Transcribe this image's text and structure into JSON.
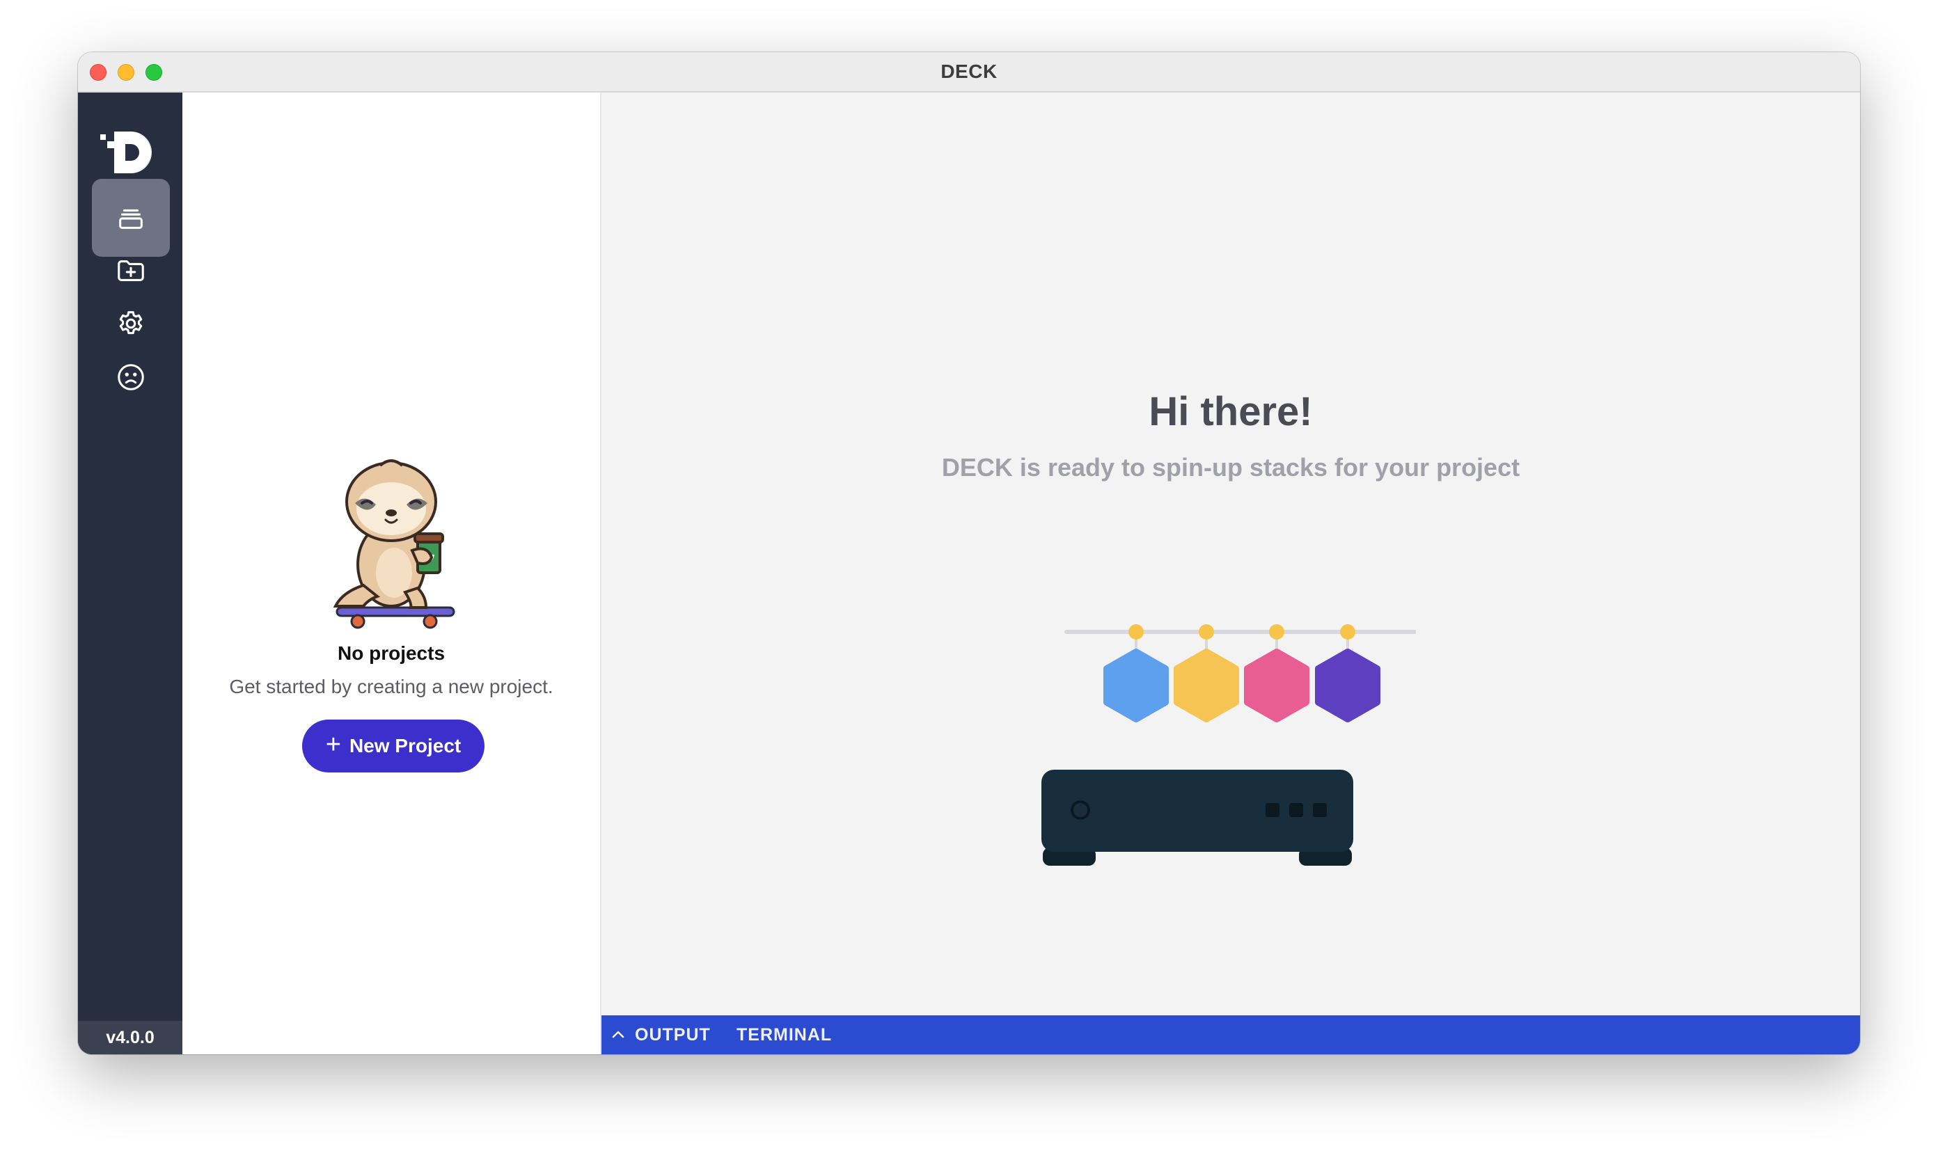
{
  "window": {
    "title": "DECK"
  },
  "rail": {
    "items": [
      {
        "name": "projects",
        "icon": "stack-icon",
        "active": true
      },
      {
        "name": "import-project",
        "icon": "folder-plus-icon",
        "active": false
      },
      {
        "name": "settings",
        "icon": "gear-icon",
        "active": false
      },
      {
        "name": "feedback",
        "icon": "sad-face-icon",
        "active": false
      }
    ],
    "version": "v4.0.0"
  },
  "projects_panel": {
    "empty_title": "No projects",
    "empty_subtitle": "Get started by creating a new project.",
    "new_project_label": "New Project"
  },
  "main": {
    "greeting": "Hi there!",
    "subtitle": "DECK is ready to spin-up stacks for your project",
    "hexagon_colors": [
      "#5fa0ee",
      "#f6c453",
      "#e85d92",
      "#5d3fc0"
    ]
  },
  "statusbar": {
    "output_label": "OUTPUT",
    "terminal_label": "TERMINAL",
    "color": "#2b4bd1"
  }
}
